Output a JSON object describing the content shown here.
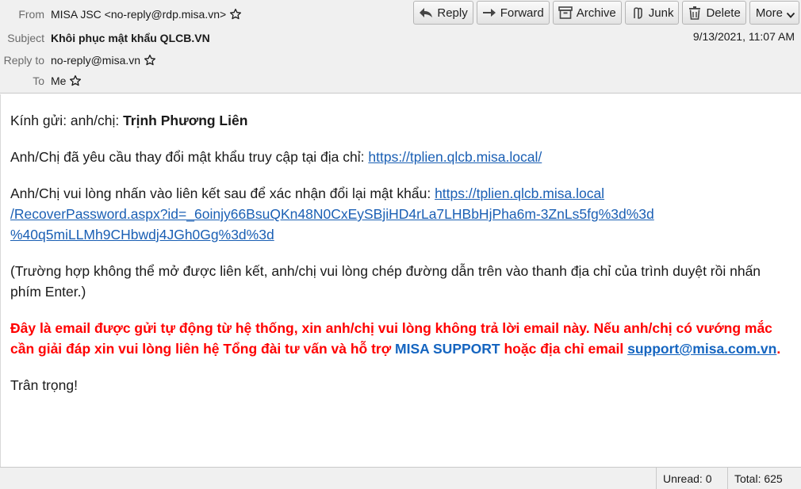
{
  "header": {
    "from_label": "From",
    "from_value": "MISA JSC <no-reply@rdp.misa.vn>",
    "subject_label": "Subject",
    "subject_value": "Khôi phục mật khẩu QLCB.VN",
    "replyto_label": "Reply to",
    "replyto_value": "no-reply@misa.vn",
    "to_label": "To",
    "to_value": "Me",
    "date": "9/13/2021, 11:07 AM"
  },
  "toolbar": {
    "reply": "Reply",
    "forward": "Forward",
    "archive": "Archive",
    "junk": "Junk",
    "delete": "Delete",
    "more": "More"
  },
  "body": {
    "greeting_prefix": "Kính gửi: anh/chị: ",
    "greeting_name": "Trịnh Phương Liên",
    "line1_text": "Anh/Chị đã yêu cầu thay đổi mật khẩu truy cập tại địa chỉ: ",
    "line1_link": "https://tplien.qlcb.misa.local/",
    "line2_text": "Anh/Chị vui lòng nhấn vào liên kết sau để xác nhận đổi lại mật khẩu: ",
    "line2_link_part1": "https://tplien.qlcb.misa.local",
    "line2_link_part2": "/RecoverPassword.aspx?id=_6oinjy66BsuQKn48N0CxEySBjiHD4rLa7LHBbHjPha6m-3ZnLs5fg%3d%3d",
    "line2_link_part3": "%40q5miLLMh9CHbwdj4JGh0Gg%3d%3d",
    "line3": "(Trường hợp không thể mở được liên kết, anh/chị vui lòng chép đường dẫn trên vào thanh địa chỉ của trình duyệt rồi nhấn phím Enter.)",
    "warning_part1": "Đây là email được gửi tự động từ hệ thống, xin anh/chị vui lòng không trả lời email này. Nếu anh/chị có vướng mắc cần giải đáp xin vui lòng liên hệ Tổng đài tư vấn và hỗ trợ ",
    "warning_support": "MISA SUPPORT",
    "warning_part2": " hoặc địa chỉ email ",
    "warning_email": "support@misa.com.vn",
    "warning_end": ".",
    "closing": "Trân trọng!"
  },
  "status": {
    "unread": "Unread: 0",
    "total": "Total: 625"
  },
  "colors": {
    "warning": "#ff0000",
    "support_blue": "#1565c0",
    "link": "#1a5fb4"
  },
  "icons": [
    "star-icon",
    "reply-icon",
    "forward-icon",
    "archive-icon",
    "junk-icon",
    "delete-icon",
    "chevron-down-icon"
  ]
}
